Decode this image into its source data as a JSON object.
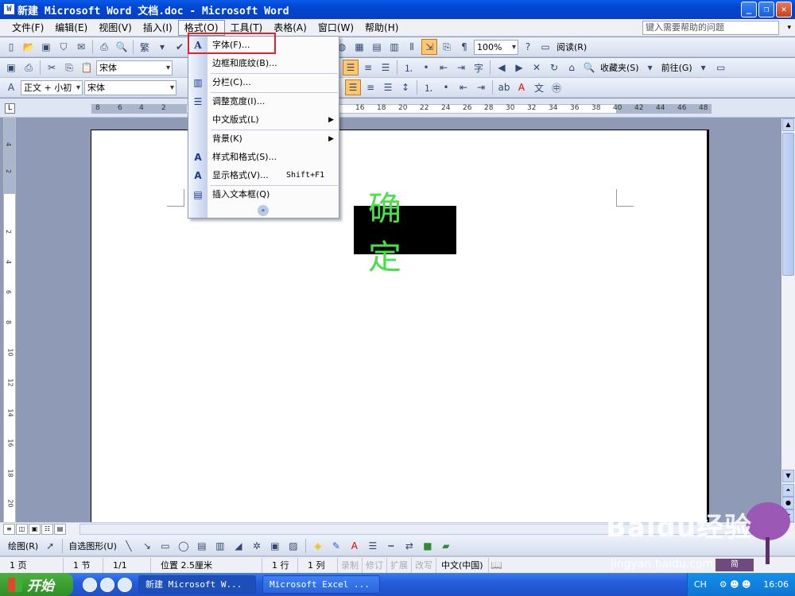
{
  "window": {
    "title": "新建 Microsoft Word 文档.doc - Microsoft Word",
    "app_icon": "W"
  },
  "menubar": {
    "items": [
      "文件(F)",
      "编辑(E)",
      "视图(V)",
      "插入(I)",
      "格式(O)",
      "工具(T)",
      "表格(A)",
      "窗口(W)",
      "帮助(H)"
    ],
    "help_placeholder": "键入需要帮助的问题"
  },
  "toolbar1": {
    "trad_simp": "繁",
    "zoom": "100%",
    "read_label": "阅读(R)"
  },
  "toolbar2": {
    "font_name": "宋体",
    "favorites": "收藏夹(S)",
    "goto": "前往(G)"
  },
  "toolbar3": {
    "style": "正文 + 小初",
    "font_name": "宋体"
  },
  "ruler": {
    "tab_marker": "L",
    "numbers": [
      "8",
      "6",
      "4",
      "2",
      "16",
      "18",
      "20",
      "22",
      "24",
      "26",
      "28",
      "30",
      "32",
      "34",
      "36",
      "38",
      "40",
      "42",
      "44",
      "46",
      "48"
    ],
    "vertical_numbers": [
      "4",
      "2",
      "2",
      "4",
      "6",
      "8",
      "10",
      "12",
      "14",
      "16",
      "18",
      "20"
    ]
  },
  "document": {
    "text": "确定"
  },
  "format_menu": {
    "items": [
      {
        "icon": "A",
        "label": "字体(F)..."
      },
      {
        "icon": "",
        "label": "边框和底纹(B)..."
      },
      {
        "icon": "▥",
        "label": "分栏(C)..."
      },
      {
        "icon": "",
        "label": "调整宽度(I)..."
      },
      {
        "icon": "",
        "label": "中文版式(L)"
      },
      {
        "icon": "",
        "label": "背景(K)"
      },
      {
        "icon": "A",
        "label": "样式和格式(S)..."
      },
      {
        "icon": "A",
        "label": "显示格式(V)...",
        "shortcut": "Shift+F1"
      },
      {
        "icon": "▤",
        "label": "插入文本框(Q)"
      }
    ],
    "expand": "»"
  },
  "drawbar": {
    "draw_label": "绘图(R)",
    "autoshapes_label": "自选图形(U)"
  },
  "statusbar": {
    "page": "1 页",
    "section": "1 节",
    "page_of": "1/1",
    "position": "位置 2.5厘米",
    "line": "1 行",
    "column": "1 列",
    "rec": "录制",
    "trk": "修订",
    "ext": "扩展",
    "ovr": "改写",
    "language": "中文(中国)"
  },
  "taskbar": {
    "start": "开始",
    "tasks": [
      "新建 Microsoft W...",
      "Microsoft Excel ..."
    ],
    "ime": "CH",
    "clock": "16:06"
  },
  "watermark": {
    "logo": "Baidu经验",
    "url": "jingyan.baidu.com",
    "ime_badge": "简"
  }
}
